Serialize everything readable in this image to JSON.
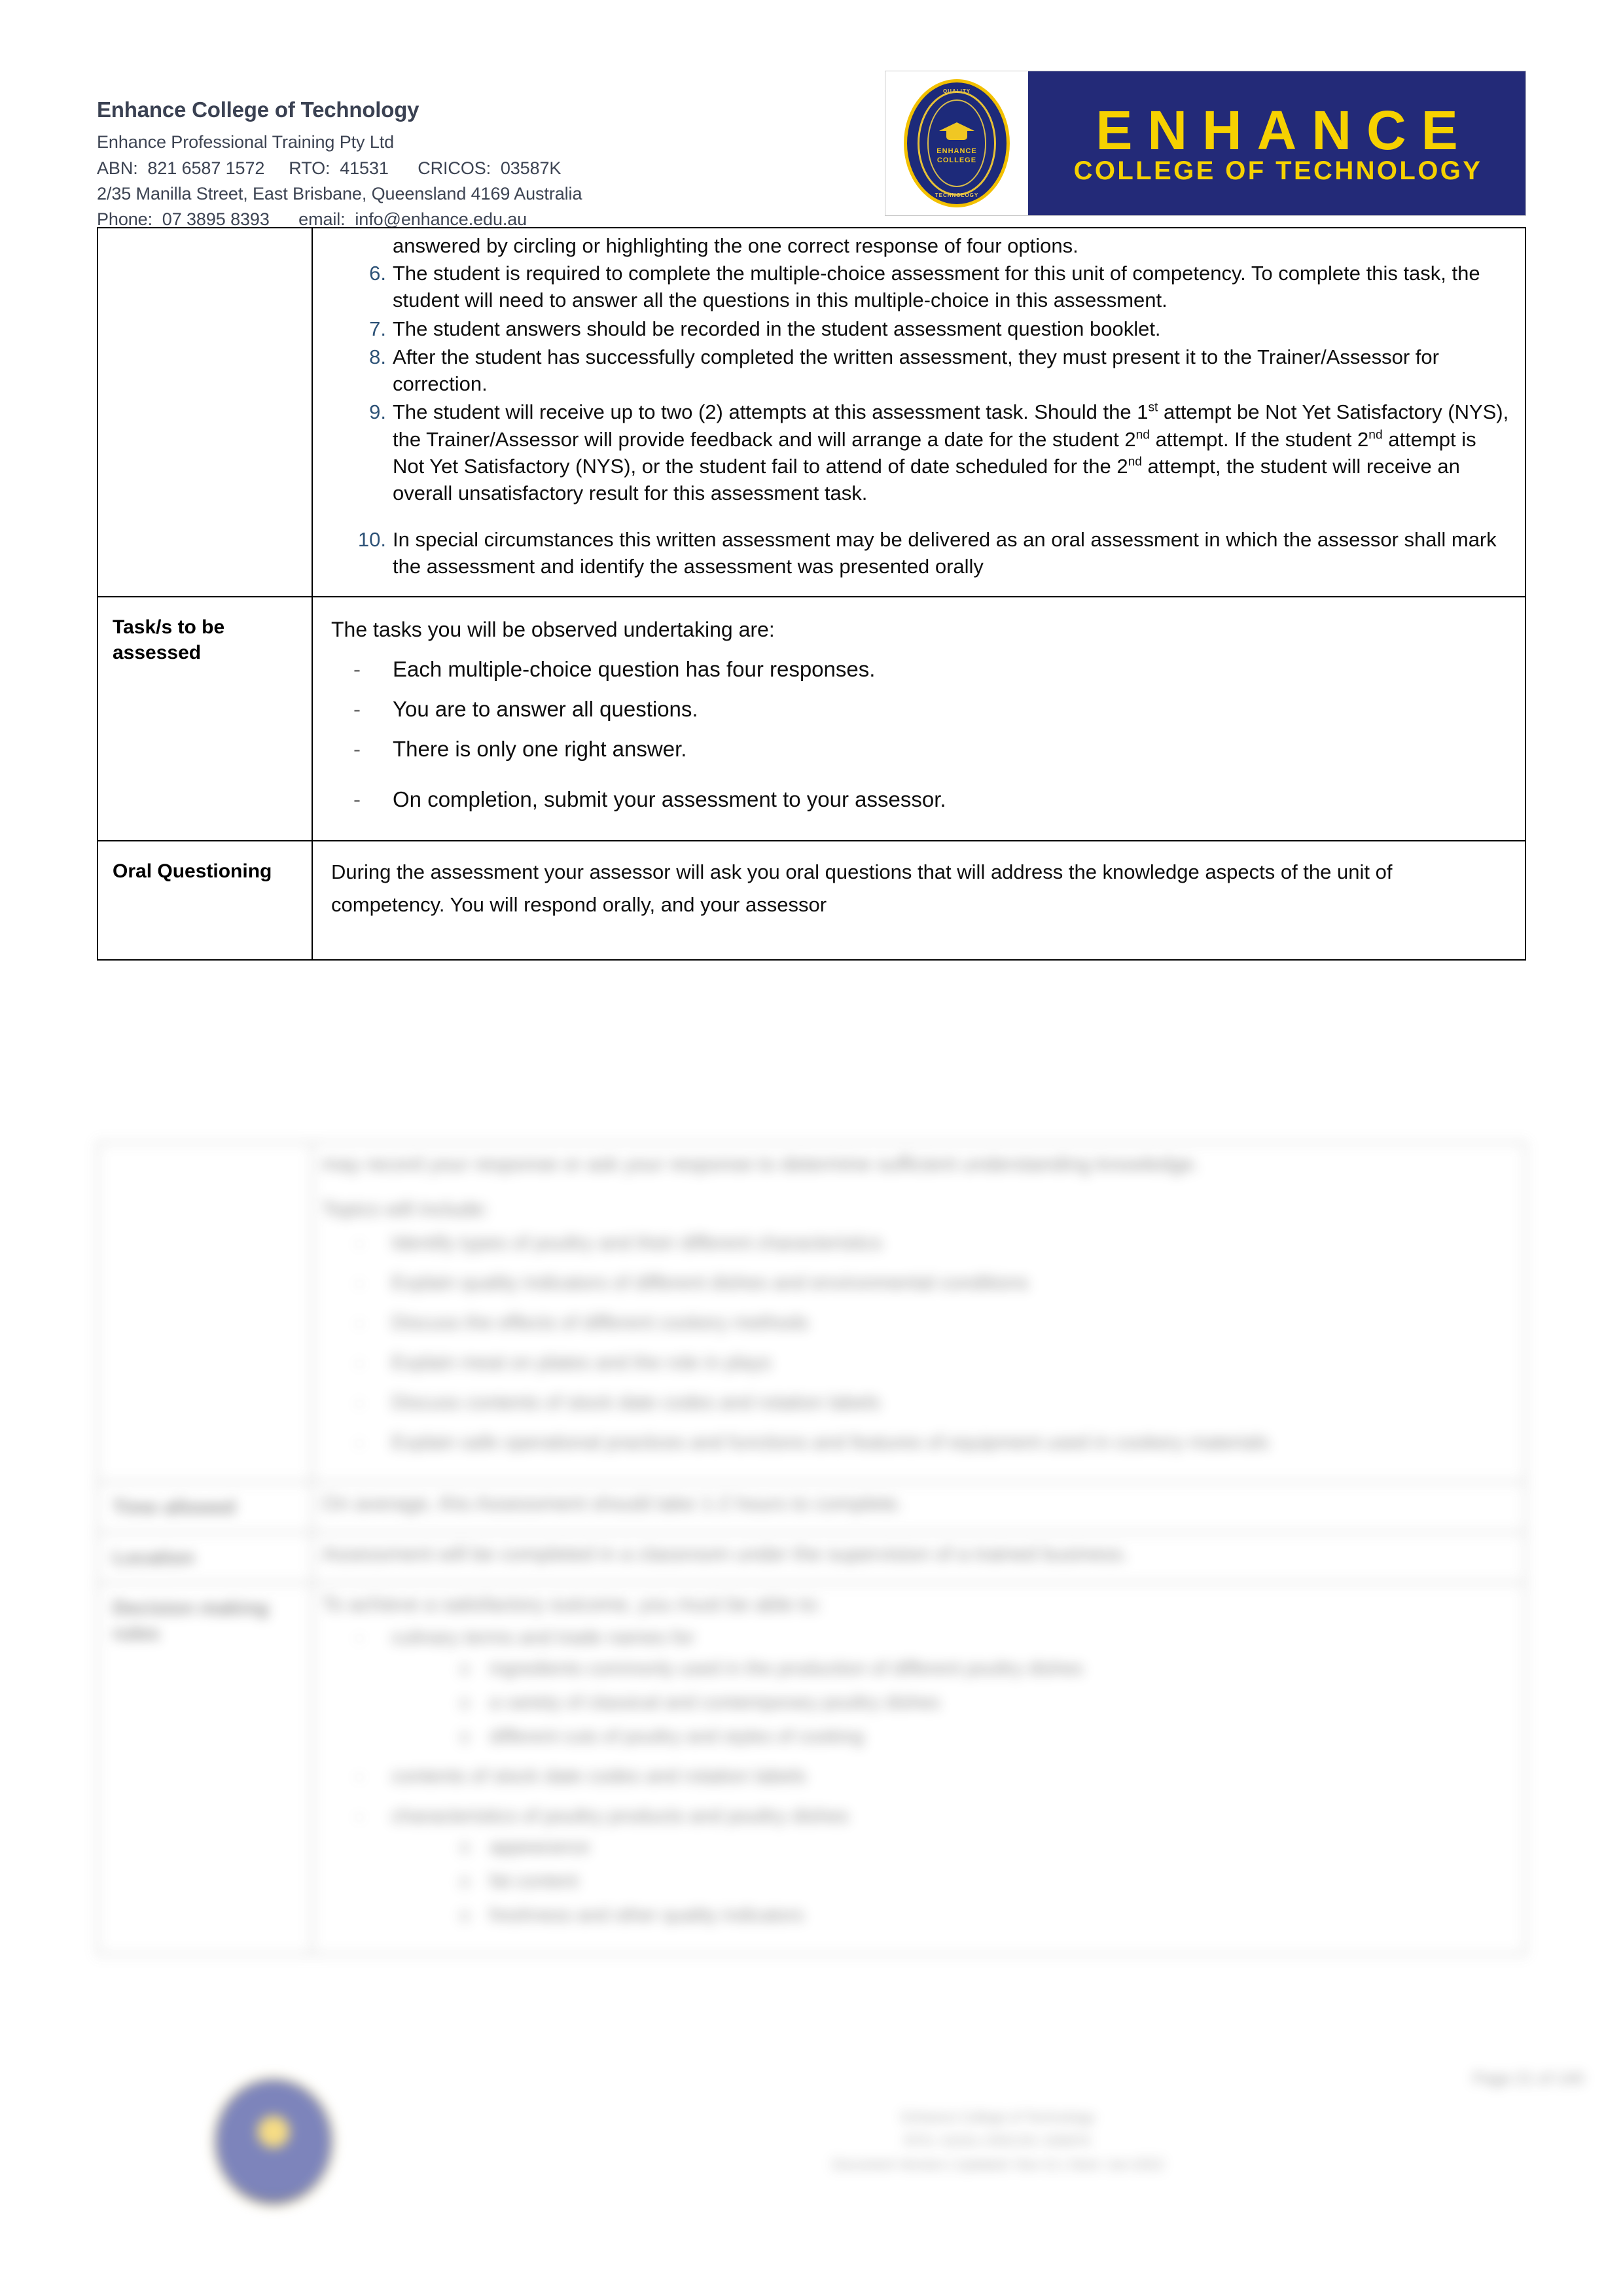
{
  "header": {
    "org_name": "Enhance College of Technology",
    "legal_name": "Enhance Professional Training Pty Ltd",
    "registration_line": "ABN:  821 6587 1572     RTO:  41531      CRICOS:  03587K",
    "address_line": "2/35 Manilla Street, East Brisbane, Queensland 4169 Australia",
    "contact_line": "Phone:  07 3895 8393      email:  info@enhance.edu.au",
    "logo": {
      "wordmark": "ENHANCE",
      "tagline": "COLLEGE OF TECHNOLOGY",
      "seal_word": "ENHANCE",
      "seal_word2": "COLLEGE",
      "seal_arc_top": "QUALITY",
      "seal_arc_bottom": "TECHNOLOGY",
      "band_color": "#232a78",
      "text_color": "#f6d100"
    }
  },
  "table": {
    "instructions_row": {
      "label": "",
      "continued_text": "answered by circling or highlighting the one correct response of four options.",
      "items": [
        {
          "num": "6.",
          "text": "The student is required to complete the multiple-choice assessment for this unit of competency. To complete this task, the student will need to answer all the questions in this multiple-choice in this assessment."
        },
        {
          "num": "7.",
          "text": "The student answers should be recorded in the student assessment question booklet."
        },
        {
          "num": "8.",
          "text": "After the student has successfully completed the written assessment, they must present it to the Trainer/Assessor for correction."
        },
        {
          "num": "9.",
          "text_part1": "The student will receive up to two (2) attempts at this assessment task. Should the 1",
          "sup1": "st",
          "text_part2": " attempt be Not Yet Satisfactory (NYS), the Trainer/Assessor will provide feedback and will arrange a date for the student 2",
          "sup2": "nd",
          "text_part3": " attempt. If the student 2",
          "sup3": "nd",
          "text_part4": " attempt is Not Yet Satisfactory (NYS), or the student fail to attend of date scheduled for the 2",
          "sup4": "nd",
          "text_part5": " attempt, the student will receive an overall unsatisfactory result for this assessment task."
        },
        {
          "num": "10.",
          "text": "In special circumstances this written assessment may be delivered as an oral assessment in which the assessor shall mark the assessment and identify the assessment was presented orally"
        }
      ]
    },
    "tasks_row": {
      "label": "Task/s to be assessed",
      "intro": "The tasks you will be observed undertaking are:",
      "bullets": [
        "Each multiple-choice question has four responses.",
        "You are to answer all questions.",
        "There is only one right answer.",
        "On completion, submit your assessment to your assessor."
      ]
    },
    "oral_row": {
      "label": "Oral Questioning",
      "paragraph": "During the assessment your assessor will ask you oral questions that will address the knowledge aspects of the unit of competency.  You will respond orally, and your assessor",
      "paragraph_cut": "may record your response or ask your response to determine sufficient understanding knowledge.",
      "topics_intro": "Topics will include:",
      "topics": [
        "Identify types of poultry and their different characteristics",
        "Explain quality indicators of different dishes and environmental conditions",
        "Discuss the effects of different cookery methods",
        "Explain meat on plates and the role in plays",
        "Discuss contents of stock date codes and rotation labels",
        "Explain safe operational practices and functions and features of equipment used in cookery materials"
      ]
    },
    "time_row": {
      "label": "Time allowed",
      "text": "On average, this Assessment should take 1-2 hours to complete."
    },
    "conditions_row": {
      "label": "Location",
      "text": "Assessment will be completed in a classroom under the supervision of a trained business."
    },
    "criteria_row": {
      "label": "Decision making rules",
      "intro": "To achieve a satisfactory outcome, you must be able to:",
      "bullets": [
        {
          "text": "culinary terms and trade names for",
          "sub": [
            "ingredients commonly used in the production of different poultry dishes",
            "a variety of classical and contemporary poultry dishes",
            "different cuts of poultry and styles of cooking"
          ]
        },
        {
          "text": "contents of stock date codes and rotation labels",
          "sub": []
        },
        {
          "text": "characteristics of poultry products and poultry dishes",
          "sub": [
            "appearance",
            "fat content",
            "freshness and other quality indicators"
          ]
        }
      ]
    }
  },
  "footer": {
    "line1": "Enhance College of Technology",
    "line2": "RTO: 41531       CRICOS: 03587K",
    "line3": "Document Version  |  Updated:  Nov-21   |  Next:  Jun-2022",
    "page_number": "Page 21 of 140"
  },
  "colors": {
    "list_number": "#2d5277",
    "brand_navy": "#232a78",
    "brand_gold": "#f6d100",
    "header_text": "#3c4353"
  }
}
